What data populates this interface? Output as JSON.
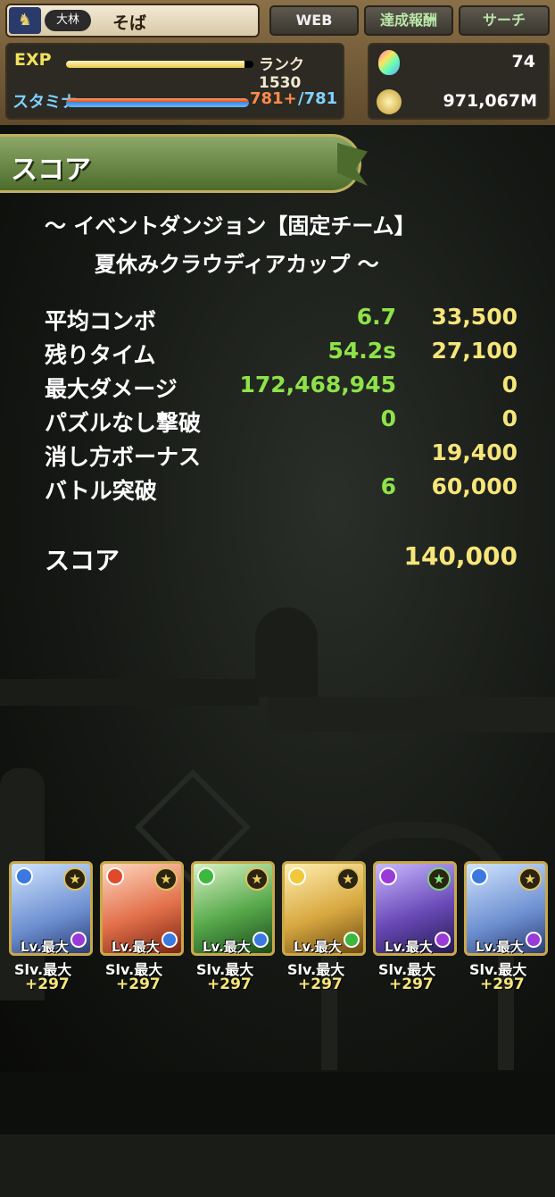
{
  "status": {
    "player_name": "そば",
    "rank_badge": "大林",
    "tabs": {
      "web": "WEB",
      "achievements": "達成報酬",
      "search": "サーチ"
    },
    "exp_label": "EXP",
    "exp_fraction": 0.95,
    "rank_text": "ランク1530",
    "stamina_label": "スタミナ",
    "stamina_current": "781+",
    "stamina_max": "/781",
    "stamina_fraction": 1.0,
    "magic_stones": "74",
    "coins": "971,067M"
  },
  "score_panel": {
    "header": "スコア",
    "dungeon_line1": "～ イベントダンジョン【固定チーム】",
    "dungeon_line2": "夏休みクラウディアカップ ～",
    "rows": [
      {
        "label": "平均コンボ",
        "value": "6.7",
        "points": "33,500"
      },
      {
        "label": "残りタイム",
        "value": "54.2s",
        "points": "27,100"
      },
      {
        "label": "最大ダメージ",
        "value": "172,468,945",
        "points": "0"
      },
      {
        "label": "パズルなし撃破",
        "value": "0",
        "points": "0"
      },
      {
        "label": "消し方ボーナス",
        "value": "",
        "points": "19,400"
      },
      {
        "label": "バトル突破",
        "value": "6",
        "points": "60,000"
      }
    ],
    "total_label": "スコア",
    "total_value": "140,000"
  },
  "team": [
    {
      "color": "blue",
      "attr": "water",
      "level": "Lv.最大",
      "skill": "Slv.最大",
      "plus": "+297"
    },
    {
      "color": "red",
      "attr": "fire",
      "level": "Lv.最大",
      "skill": "Slv.最大",
      "plus": "+297"
    },
    {
      "color": "green",
      "attr": "wood",
      "level": "Lv.最大",
      "skill": "Slv.最大",
      "plus": "+297"
    },
    {
      "color": "yellow",
      "attr": "light",
      "level": "Lv.最大",
      "skill": "Slv.最大",
      "plus": "+297"
    },
    {
      "color": "purple",
      "attr": "dark",
      "level": "Lv.最大",
      "skill": "Slv.最大",
      "plus": "+297"
    },
    {
      "color": "blue",
      "attr": "water",
      "level": "Lv.最大",
      "skill": "Slv.最大",
      "plus": "+297"
    }
  ]
}
